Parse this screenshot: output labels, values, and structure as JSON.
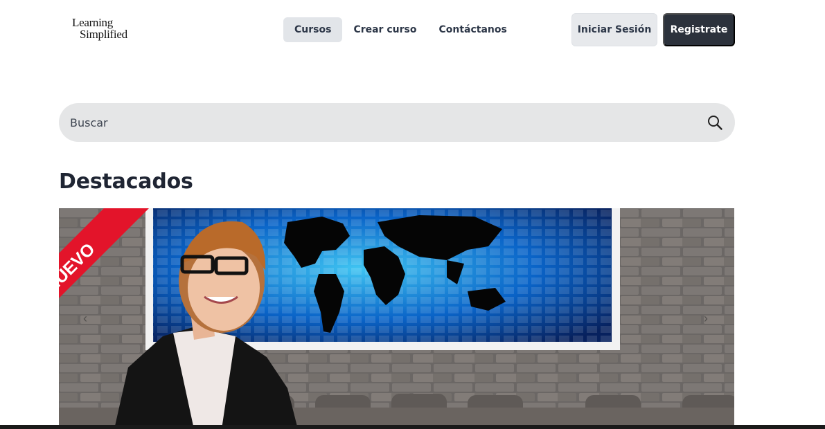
{
  "brand": {
    "line1": "Learning",
    "line2": "Simplified"
  },
  "nav": {
    "items": [
      {
        "label": "Cursos",
        "active": true
      },
      {
        "label": "Crear curso",
        "active": false
      },
      {
        "label": "Contáctanos",
        "active": false
      }
    ]
  },
  "auth": {
    "login_label": "Iniciar Sesión",
    "register_label": "Registrate"
  },
  "search": {
    "placeholder": "Buscar",
    "icon": "search-icon"
  },
  "featured": {
    "title": "Destacados",
    "slide": {
      "badge": "NUEVO",
      "image": "teacher-in-front-of-world-map"
    },
    "prev_icon": "chevron-left-icon",
    "next_icon": "chevron-right-icon"
  },
  "colors": {
    "accent_dark": "#2c323c",
    "badge_red": "#e3142a",
    "search_bg": "#e5e6e7"
  }
}
